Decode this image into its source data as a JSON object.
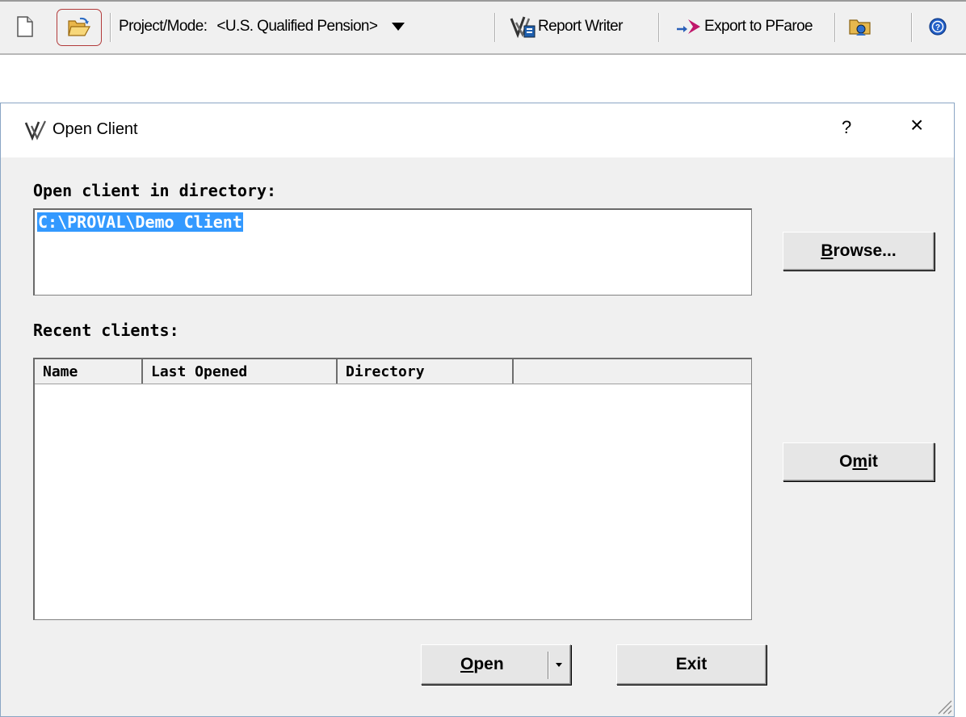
{
  "toolbar": {
    "project_mode_label": "Project/Mode:",
    "project_mode_value": "<U.S. Qualified Pension>",
    "report_writer_label": "Report Writer",
    "export_label": "Export to PFaroe"
  },
  "dialog": {
    "title": "Open Client",
    "help_label": "?",
    "close_label": "×",
    "directory_label": "Open client in directory:",
    "directory_value": "C:\\PROVAL\\Demo Client",
    "recent_label": "Recent clients:",
    "columns": [
      "Name",
      "Last Opened",
      "Directory"
    ],
    "buttons": {
      "browse": {
        "mnemonic": "B",
        "rest": "rowse..."
      },
      "omit": {
        "pre": "O",
        "mnemonic": "m",
        "rest": "it"
      },
      "open": {
        "mnemonic": "O",
        "rest": "pen"
      },
      "exit": "Exit"
    }
  }
}
